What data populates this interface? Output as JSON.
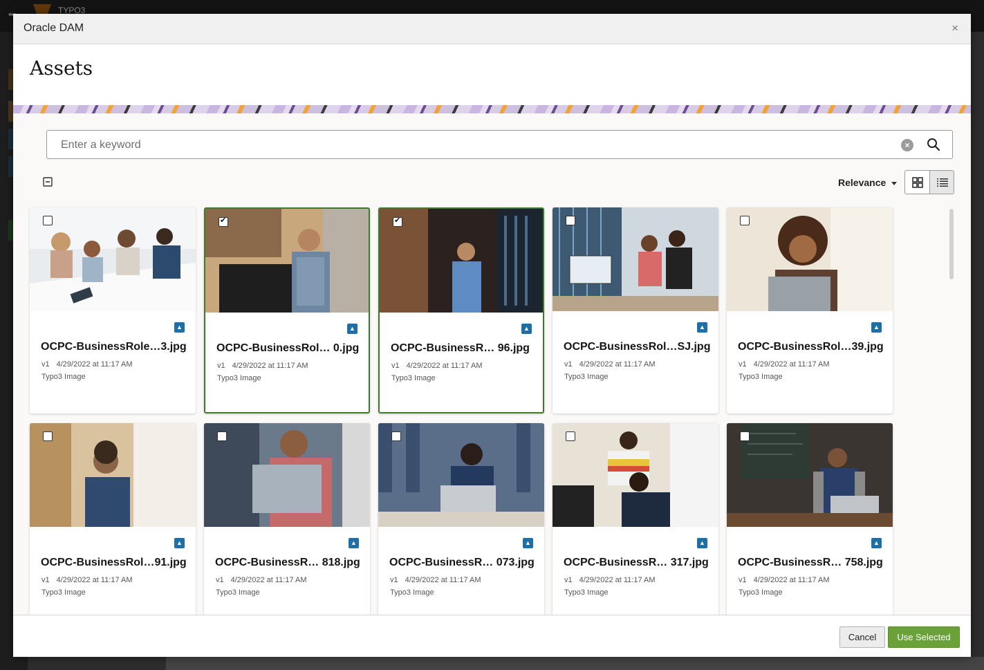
{
  "background_app": {
    "title": "TYPO3"
  },
  "dialog": {
    "title": "Oracle DAM",
    "close_symbol": "×",
    "heading": "Assets",
    "search": {
      "placeholder": "Enter a keyword",
      "value": ""
    },
    "sort": {
      "selected": "Relevance"
    },
    "view_mode": "grid",
    "colors": {
      "selected_border": "#3d7a2a",
      "primary_button": "#6aa138",
      "info_icon": "#1e6fa6"
    },
    "assets": [
      {
        "name": "OCPC-BusinessRole…3.jpg",
        "version": "v1",
        "date": "4/29/2022 at 11:17 AM",
        "type": "Typo3 Image",
        "selected": false
      },
      {
        "name": "OCPC-BusinessRol… 0.jpg",
        "version": "v1",
        "date": "4/29/2022 at 11:17 AM",
        "type": "Typo3 Image",
        "selected": true
      },
      {
        "name": "OCPC-BusinessR…  96.jpg",
        "version": "v1",
        "date": "4/29/2022 at 11:17 AM",
        "type": "Typo3 Image",
        "selected": true
      },
      {
        "name": "OCPC-BusinessRol…SJ.jpg",
        "version": "v1",
        "date": "4/29/2022 at 11:17 AM",
        "type": "Typo3 Image",
        "selected": false
      },
      {
        "name": "OCPC-BusinessRol…39.jpg",
        "version": "v1",
        "date": "4/29/2022 at 11:17 AM",
        "type": "Typo3 Image",
        "selected": false
      },
      {
        "name": "OCPC-BusinessRol…91.jpg",
        "version": "v1",
        "date": "4/29/2022 at 11:17 AM",
        "type": "Typo3 Image",
        "selected": false
      },
      {
        "name": "OCPC-BusinessR… 818.jpg",
        "version": "v1",
        "date": "4/29/2022 at 11:17 AM",
        "type": "Typo3 Image",
        "selected": false
      },
      {
        "name": "OCPC-BusinessR… 073.jpg",
        "version": "v1",
        "date": "4/29/2022 at 11:17 AM",
        "type": "Typo3 Image",
        "selected": false
      },
      {
        "name": "OCPC-BusinessR… 317.jpg",
        "version": "v1",
        "date": "4/29/2022 at 11:17 AM",
        "type": "Typo3 Image",
        "selected": false
      },
      {
        "name": "OCPC-BusinessR… 758.jpg",
        "version": "v1",
        "date": "4/29/2022 at 11:17 AM",
        "type": "Typo3 Image",
        "selected": false
      }
    ],
    "footer": {
      "cancel_label": "Cancel",
      "use_selected_label": "Use Selected"
    }
  }
}
